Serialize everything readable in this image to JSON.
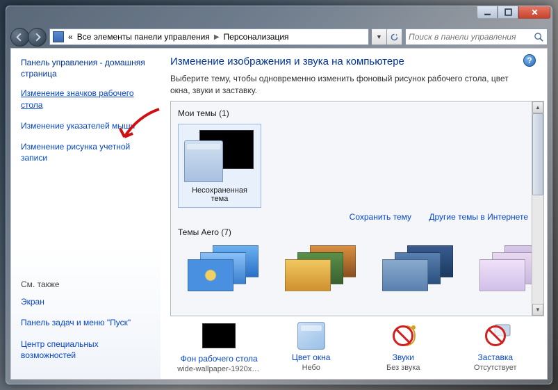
{
  "breadcrumb": {
    "root_marker": "«",
    "parent": "Все элементы панели управления",
    "current": "Персонализация"
  },
  "search": {
    "placeholder": "Поиск в панели управления"
  },
  "sidebar": {
    "home": "Панель управления - домашняя страница",
    "links": [
      "Изменение значков рабочего стола",
      "Изменение указателей мыши",
      "Изменение рисунка учетной записи"
    ],
    "see_also_header": "См. также",
    "see_also": [
      "Экран",
      "Панель задач и меню \"Пуск\"",
      "Центр специальных возможностей"
    ]
  },
  "main": {
    "heading": "Изменение изображения и звука на компьютере",
    "subtitle": "Выберите тему, чтобы одновременно изменить фоновый рисунок рабочего стола, цвет окна, звуки и заставку.",
    "my_themes_label": "Мои темы (1)",
    "unsaved_theme": "Несохраненная тема",
    "save_theme": "Сохранить тему",
    "more_themes": "Другие темы в Интернете",
    "aero_label": "Темы Aero (7)"
  },
  "bottom": {
    "wallpaper": {
      "label": "Фон рабочего стола",
      "value": "wide-wallpaper-1920x10…"
    },
    "color": {
      "label": "Цвет окна",
      "value": "Небо"
    },
    "sounds": {
      "label": "Звуки",
      "value": "Без звука"
    },
    "screensaver": {
      "label": "Заставка",
      "value": "Отсутствует"
    }
  }
}
